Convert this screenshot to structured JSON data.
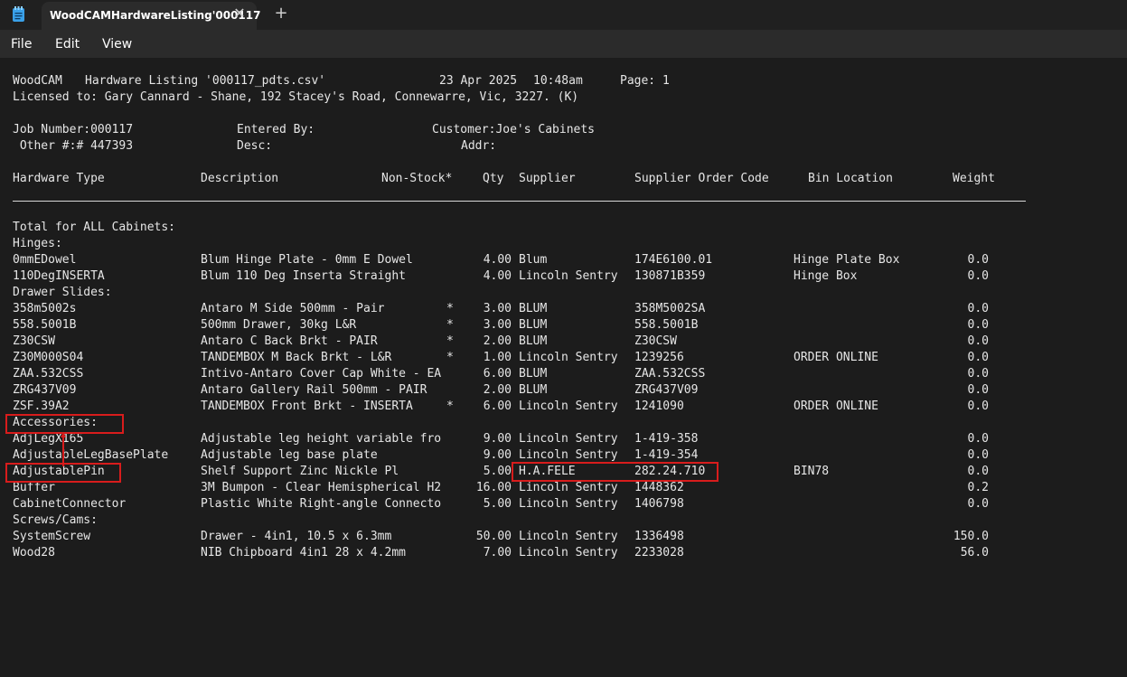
{
  "window": {
    "tab_title": "WoodCAMHardwareListing'000117",
    "close_glyph": "✕",
    "new_tab_glyph": "+",
    "app_icon": "notepad-icon"
  },
  "menu": {
    "file": "File",
    "edit": "Edit",
    "view": "View"
  },
  "report": {
    "header": {
      "program": "WoodCAM",
      "listing": "Hardware Listing '000117_pdts.csv'",
      "date": "23 Apr 2025",
      "time": "10:48am",
      "page": "Page: 1",
      "licensed": "Licensed to: Gary Cannard - Shane, 192 Stacey's Road, Connewarre, Vic, 3227. (K)",
      "job_number": "Job Number:000117",
      "entered_by": "Entered By:",
      "customer": "Customer:Joe's Cabinets",
      "other": " Other #:# 447393",
      "desc": "Desc:",
      "addr": "Addr:"
    },
    "columns": {
      "type": "Hardware Type",
      "description": "Description",
      "nonstock": "Non-Stock*",
      "qty": "Qty",
      "supplier": "Supplier",
      "order_code": "Supplier Order Code",
      "bin": "Bin Location",
      "weight": "Weight"
    },
    "total_label": "Total for ALL Cabinets:",
    "groups": {
      "hinges": "Hinges:",
      "drawer_slides": "Drawer Slides:",
      "accessories": "Accessories:",
      "screws": "Screws/Cams:"
    },
    "rows": [
      {
        "type": "0mmEDowel",
        "desc": "Blum Hinge Plate - 0mm E Dowel",
        "ns": "",
        "qty": "4.00",
        "sup": "Blum",
        "code": "174E6100.01",
        "bin": "Hinge Plate Box",
        "wt": "0.0"
      },
      {
        "type": "110DegINSERTA",
        "desc": "Blum 110 Deg Inserta Straight",
        "ns": "",
        "qty": "4.00",
        "sup": "Lincoln Sentry",
        "code": "130871B359",
        "bin": "Hinge Box",
        "wt": "0.0"
      },
      {
        "type": "358m5002s",
        "desc": "Antaro M Side 500mm - Pair",
        "ns": "*",
        "qty": "3.00",
        "sup": "BLUM",
        "code": "358M5002SA",
        "bin": "",
        "wt": "0.0"
      },
      {
        "type": "558.5001B",
        "desc": "500mm Drawer, 30kg L&R",
        "ns": "*",
        "qty": "3.00",
        "sup": "BLUM",
        "code": "558.5001B",
        "bin": "",
        "wt": "0.0"
      },
      {
        "type": "Z30CSW",
        "desc": "Antaro C Back Brkt - PAIR",
        "ns": "*",
        "qty": "2.00",
        "sup": "BLUM",
        "code": "Z30CSW",
        "bin": "",
        "wt": "0.0"
      },
      {
        "type": "Z30M000S04",
        "desc": "TANDEMBOX M Back Brkt - L&R",
        "ns": "*",
        "qty": "1.00",
        "sup": "Lincoln Sentry",
        "code": "1239256",
        "bin": "ORDER ONLINE",
        "wt": "0.0"
      },
      {
        "type": "ZAA.532CSS",
        "desc": "Intivo-Antaro Cover Cap White - EA",
        "ns": "",
        "qty": "6.00",
        "sup": "BLUM",
        "code": "ZAA.532CSS",
        "bin": "",
        "wt": "0.0"
      },
      {
        "type": "ZRG437V09",
        "desc": "Antaro Gallery Rail 500mm - PAIR",
        "ns": "",
        "qty": "2.00",
        "sup": "BLUM",
        "code": "ZRG437V09",
        "bin": "",
        "wt": "0.0"
      },
      {
        "type": "ZSF.39A2",
        "desc": "TANDEMBOX Front Brkt - INSERTA",
        "ns": "*",
        "qty": "6.00",
        "sup": "Lincoln Sentry",
        "code": "1241090",
        "bin": "ORDER ONLINE",
        "wt": "0.0"
      },
      {
        "type": "AdjLegX165",
        "desc": "Adjustable leg height variable fro",
        "ns": "",
        "qty": "9.00",
        "sup": "Lincoln Sentry",
        "code": "1-419-358",
        "bin": "",
        "wt": "0.0"
      },
      {
        "type": "AdjustableLegBasePlate",
        "desc": "Adjustable leg base plate",
        "ns": "",
        "qty": "9.00",
        "sup": "Lincoln Sentry",
        "code": "1-419-354",
        "bin": "",
        "wt": "0.0"
      },
      {
        "type": "AdjustablePin",
        "desc": "Shelf Support Zinc Nickle Pl",
        "ns": "",
        "qty": "5.00",
        "sup": "H.A.FELE",
        "code": "282.24.710",
        "bin": "BIN78",
        "wt": "0.0"
      },
      {
        "type": "Buffer",
        "desc": "3M Bumpon - Clear Hemispherical H2",
        "ns": "",
        "qty": "16.00",
        "sup": "Lincoln Sentry",
        "code": "1448362",
        "bin": "",
        "wt": "0.2"
      },
      {
        "type": "CabinetConnector",
        "desc": "Plastic White Right-angle Connecto",
        "ns": "",
        "qty": "5.00",
        "sup": "Lincoln Sentry",
        "code": "1406798",
        "bin": "",
        "wt": "0.0"
      },
      {
        "type": "SystemScrew",
        "desc": "Drawer - 4in1, 10.5 x 6.3mm",
        "ns": "",
        "qty": "50.00",
        "sup": "Lincoln Sentry",
        "code": "1336498",
        "bin": "",
        "wt": "150.0"
      },
      {
        "type": "Wood28",
        "desc": "NIB Chipboard 4in1 28 x 4.2mm",
        "ns": "",
        "qty": "7.00",
        "sup": "Lincoln Sentry",
        "code": "2233028",
        "bin": "",
        "wt": "56.0"
      }
    ]
  },
  "annotations": {
    "color": "#d81c1c"
  }
}
